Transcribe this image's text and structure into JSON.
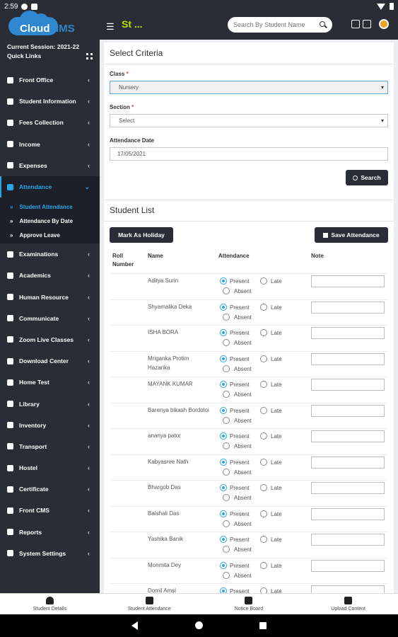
{
  "status_bar": {
    "time": "2:59"
  },
  "app": {
    "logo_part1": "Cloud",
    "logo_part2": "IMS",
    "title": "St ...",
    "search_placeholder": "Search By Student Name"
  },
  "sidebar": {
    "session": "Current Session: 2021-22",
    "quick_links": "Quick Links",
    "items": [
      {
        "label": "Front Office",
        "icon": "front-office-icon"
      },
      {
        "label": "Student Information",
        "icon": "user-icon"
      },
      {
        "label": "Fees Collection",
        "icon": "money-icon"
      },
      {
        "label": "Income",
        "icon": "dollar-icon"
      },
      {
        "label": "Expenses",
        "icon": "credit-card-icon"
      },
      {
        "label": "Attendance",
        "icon": "calendar-icon"
      },
      {
        "label": "Examinations",
        "icon": "map-icon"
      },
      {
        "label": "Academics",
        "icon": "mortarboard-icon"
      },
      {
        "label": "Human Resource",
        "icon": "sitemap-icon"
      },
      {
        "label": "Communicate",
        "icon": "bullhorn-icon"
      },
      {
        "label": "Zoom Live Classes",
        "icon": "video-icon"
      },
      {
        "label": "Download Center",
        "icon": "download-icon"
      },
      {
        "label": "Home Test",
        "icon": "flask-icon"
      },
      {
        "label": "Library",
        "icon": "book-icon"
      },
      {
        "label": "Inventory",
        "icon": "box-icon"
      },
      {
        "label": "Transport",
        "icon": "bus-icon"
      },
      {
        "label": "Hostel",
        "icon": "building-icon"
      },
      {
        "label": "Certificate",
        "icon": "certificate-icon"
      },
      {
        "label": "Front CMS",
        "icon": "globe-icon"
      },
      {
        "label": "Reports",
        "icon": "chart-icon"
      },
      {
        "label": "System Settings",
        "icon": "gears-icon"
      }
    ],
    "attendance_sub": [
      "Student Attendance",
      "Attendance By Date",
      "Approve Leave"
    ]
  },
  "criteria": {
    "heading": "Select Criteria",
    "class_label": "Class",
    "class_value": "Nursery",
    "section_label": "Section",
    "section_value": "Select",
    "date_label": "Attendance Date",
    "date_value": "17/05/2021",
    "search_button": "Search"
  },
  "student_list": {
    "heading": "Student List",
    "holiday_button": "Mark As Holiday",
    "save_button": "Save Attendance",
    "columns": {
      "roll": "Roll Number",
      "name": "Name",
      "attendance": "Attendance",
      "note": "Note"
    },
    "options": {
      "present": "Present",
      "late": "Late",
      "absent": "Absent"
    },
    "students": [
      "Aditya Surin",
      "Shyamalika Deka",
      "ISHA BORA",
      "Mriganka Protim Hazarika",
      "MAYANK KUMAR",
      "Barenya bikash Bordoloi",
      "ananya pator",
      "Kabyasree Nath",
      "Bhargob Das",
      "Baishali Das",
      "Yashika Banik",
      "Monmita Dey",
      "Domil Amsi"
    ]
  },
  "bottom_nav": [
    {
      "label": "Student Details",
      "icon": "user-icon"
    },
    {
      "label": "Student Attendance",
      "icon": "clipboard-icon"
    },
    {
      "label": "Notice Board",
      "icon": "envelope-icon"
    },
    {
      "label": "Upload Content",
      "icon": "upload-icon"
    }
  ]
}
